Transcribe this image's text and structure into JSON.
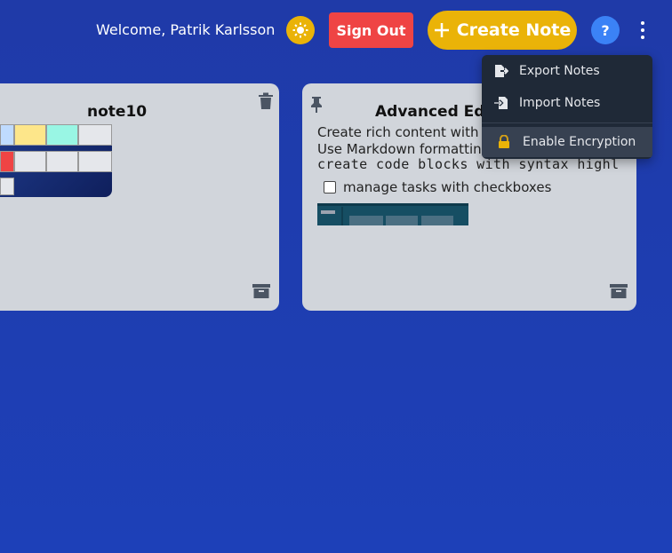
{
  "header": {
    "welcome_text": "Welcome, Patrik Karlsson",
    "sign_out_label": "Sign Out",
    "create_note_label": "Create Note",
    "help_label": "?"
  },
  "notes": [
    {
      "title": "note10",
      "icons": [
        "trash-icon",
        "archive-icon"
      ]
    },
    {
      "title": "Advanced Editor",
      "lines": [
        "Create rich content with our",
        "Use Markdown formatting",
        "create code blocks with syntax highl"
      ],
      "task": {
        "label": "manage tasks with checkboxes",
        "checked": false
      },
      "icons": [
        "pin-icon",
        "archive-icon"
      ]
    }
  ],
  "menu": {
    "items": [
      {
        "label": "Export Notes",
        "icon": "export-file-icon"
      },
      {
        "label": "Import Notes",
        "icon": "import-file-icon"
      },
      {
        "label": "Enable Encryption",
        "icon": "lock-icon",
        "highlighted": true
      }
    ]
  },
  "colors": {
    "background": "#1f3aa8",
    "accent_yellow": "#eab308",
    "danger_red": "#ef4444",
    "help_blue": "#3b82f6",
    "card": "#d1d5db",
    "menu_bg": "#1f2937"
  }
}
